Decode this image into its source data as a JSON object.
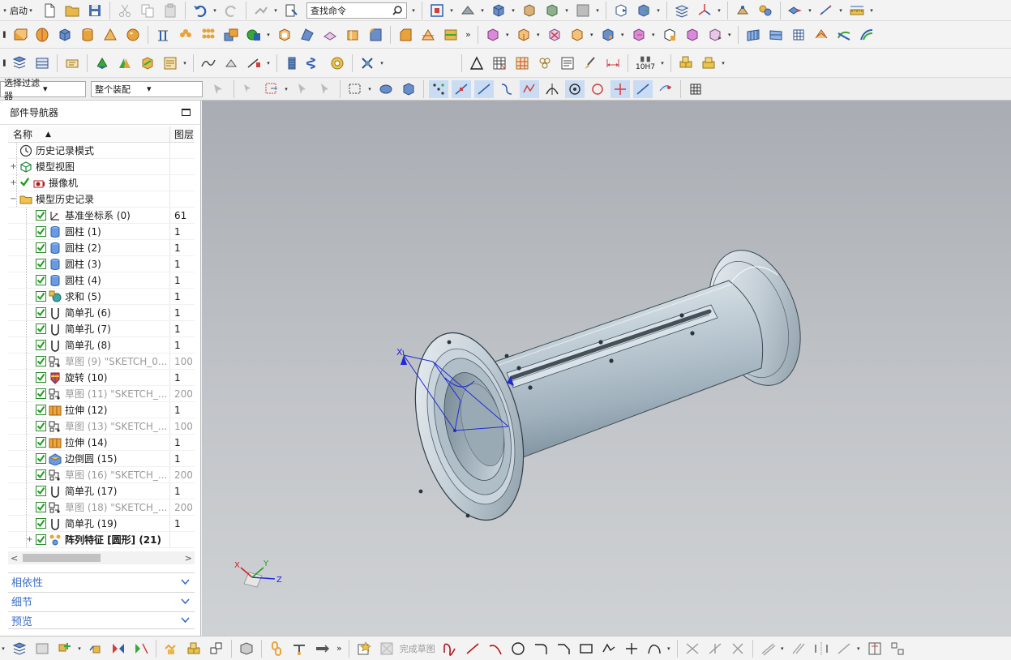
{
  "app": {
    "start_label": "启动",
    "search_placeholder": "查找命令",
    "more_glyph": "»"
  },
  "selection_bar": {
    "filter_value": "选择过滤器",
    "scope_value": "整个装配",
    "dropdown_caret": "▾"
  },
  "navigator": {
    "title": "部件导航器",
    "col_name": "名称",
    "col_layer": "图层",
    "sort_glyph": "▲",
    "items": [
      {
        "label": "历史记录模式",
        "layer": "",
        "icon": "clock-icon",
        "level": 0,
        "expander": "",
        "checked": false,
        "dim": false,
        "bold": false,
        "check": "none"
      },
      {
        "label": "模型视图",
        "layer": "",
        "icon": "model-views-icon",
        "level": 0,
        "expander": "+",
        "checked": false,
        "dim": false,
        "bold": false,
        "check": "none"
      },
      {
        "label": "摄像机",
        "layer": "",
        "icon": "camera-icon",
        "level": 0,
        "expander": "+",
        "checked": true,
        "dim": false,
        "bold": false,
        "check": "tick"
      },
      {
        "label": "模型历史记录",
        "layer": "",
        "icon": "folder-icon",
        "level": 0,
        "expander": "−",
        "checked": false,
        "dim": false,
        "bold": false,
        "check": "none"
      },
      {
        "label": "基准坐标系 (0)",
        "layer": "61",
        "icon": "datum-csys-icon",
        "level": 1,
        "expander": "",
        "checked": true,
        "dim": false,
        "bold": false,
        "check": "box"
      },
      {
        "label": "圆柱 (1)",
        "layer": "1",
        "icon": "cylinder-icon",
        "level": 1,
        "expander": "",
        "checked": true,
        "dim": false,
        "bold": false,
        "check": "box"
      },
      {
        "label": "圆柱 (2)",
        "layer": "1",
        "icon": "cylinder-icon",
        "level": 1,
        "expander": "",
        "checked": true,
        "dim": false,
        "bold": false,
        "check": "box"
      },
      {
        "label": "圆柱 (3)",
        "layer": "1",
        "icon": "cylinder-icon",
        "level": 1,
        "expander": "",
        "checked": true,
        "dim": false,
        "bold": false,
        "check": "box"
      },
      {
        "label": "圆柱 (4)",
        "layer": "1",
        "icon": "cylinder-icon",
        "level": 1,
        "expander": "",
        "checked": true,
        "dim": false,
        "bold": false,
        "check": "box"
      },
      {
        "label": "求和 (5)",
        "layer": "1",
        "icon": "unite-icon",
        "level": 1,
        "expander": "",
        "checked": true,
        "dim": false,
        "bold": false,
        "check": "box"
      },
      {
        "label": "简单孔 (6)",
        "layer": "1",
        "icon": "hole-icon",
        "level": 1,
        "expander": "",
        "checked": true,
        "dim": false,
        "bold": false,
        "check": "box"
      },
      {
        "label": "简单孔 (7)",
        "layer": "1",
        "icon": "hole-icon",
        "level": 1,
        "expander": "",
        "checked": true,
        "dim": false,
        "bold": false,
        "check": "box"
      },
      {
        "label": "简单孔 (8)",
        "layer": "1",
        "icon": "hole-icon",
        "level": 1,
        "expander": "",
        "checked": true,
        "dim": false,
        "bold": false,
        "check": "box"
      },
      {
        "label": "草图 (9) \"SKETCH_0...",
        "layer": "100",
        "icon": "sketch-icon",
        "level": 1,
        "expander": "",
        "checked": true,
        "dim": true,
        "bold": false,
        "check": "box"
      },
      {
        "label": "旋转 (10)",
        "layer": "1",
        "icon": "revolve-icon",
        "level": 1,
        "expander": "",
        "checked": true,
        "dim": false,
        "bold": false,
        "check": "box"
      },
      {
        "label": "草图 (11) \"SKETCH_...",
        "layer": "200",
        "icon": "sketch-icon",
        "level": 1,
        "expander": "",
        "checked": true,
        "dim": true,
        "bold": false,
        "check": "box"
      },
      {
        "label": "拉伸 (12)",
        "layer": "1",
        "icon": "extrude-icon",
        "level": 1,
        "expander": "",
        "checked": true,
        "dim": false,
        "bold": false,
        "check": "box"
      },
      {
        "label": "草图 (13) \"SKETCH_...",
        "layer": "100",
        "icon": "sketch-icon",
        "level": 1,
        "expander": "",
        "checked": true,
        "dim": true,
        "bold": false,
        "check": "box"
      },
      {
        "label": "拉伸 (14)",
        "layer": "1",
        "icon": "extrude-icon",
        "level": 1,
        "expander": "",
        "checked": true,
        "dim": false,
        "bold": false,
        "check": "box"
      },
      {
        "label": "边倒圆 (15)",
        "layer": "1",
        "icon": "edge-blend-icon",
        "level": 1,
        "expander": "",
        "checked": true,
        "dim": false,
        "bold": false,
        "check": "box"
      },
      {
        "label": "草图 (16) \"SKETCH_...",
        "layer": "200",
        "icon": "sketch-icon",
        "level": 1,
        "expander": "",
        "checked": true,
        "dim": true,
        "bold": false,
        "check": "box"
      },
      {
        "label": "简单孔 (17)",
        "layer": "1",
        "icon": "hole-icon",
        "level": 1,
        "expander": "",
        "checked": true,
        "dim": false,
        "bold": false,
        "check": "box"
      },
      {
        "label": "草图 (18) \"SKETCH_...",
        "layer": "200",
        "icon": "sketch-icon",
        "level": 1,
        "expander": "",
        "checked": true,
        "dim": true,
        "bold": false,
        "check": "box"
      },
      {
        "label": "简单孔 (19)",
        "layer": "1",
        "icon": "hole-icon",
        "level": 1,
        "expander": "",
        "checked": true,
        "dim": false,
        "bold": false,
        "check": "box"
      },
      {
        "label": "阵列特征 [圆形] (21)",
        "layer": "",
        "icon": "pattern-icon",
        "level": 1,
        "expander": "+",
        "checked": true,
        "dim": false,
        "bold": true,
        "check": "box"
      }
    ],
    "sections": [
      {
        "label": "相依性"
      },
      {
        "label": "细节"
      },
      {
        "label": "预览"
      }
    ],
    "scroll_left": "<",
    "scroll_right": ">"
  },
  "sketch_bar": {
    "done_label": "完成草图"
  },
  "triad": {
    "x_label": "X",
    "y_label": "Y",
    "z_label": "Z"
  },
  "fit_label": "10H7",
  "colors": {
    "accent": "#3b6dc7",
    "check_green": "#1e9e1e",
    "model_body": "#b9c7d1",
    "background_top": "#a9adb3",
    "background_bottom": "#cfd2d5"
  }
}
